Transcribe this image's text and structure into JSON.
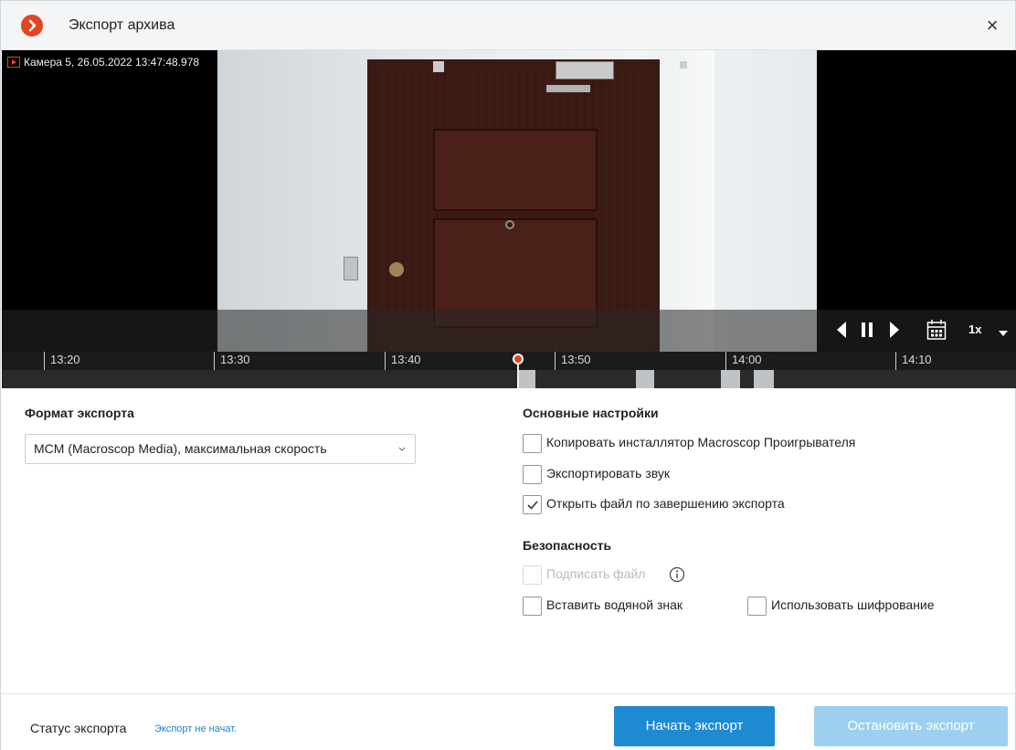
{
  "window": {
    "title": "Экспорт архива",
    "close_label": "×",
    "accent_color": "#e2451f",
    "primary_color": "#1e8ad2"
  },
  "video": {
    "camera_label": "Камера 5, 26.05.2022 13:47:48.978",
    "controls": {
      "prev_icon": "step-back-icon",
      "pause_icon": "pause-icon",
      "next_icon": "step-forward-icon",
      "calendar_icon": "calendar-icon",
      "speed": "1x",
      "speed_menu_icon": "chevron-down-icon"
    }
  },
  "timeline": {
    "ticks": [
      "13:20",
      "13:30",
      "13:40",
      "13:50",
      "14:00",
      "14:10"
    ],
    "current_time": "13:47:48.978"
  },
  "export_format": {
    "title": "Формат экспорта",
    "selected": "MCM (Macroscop Media), максимальная скорость"
  },
  "main_settings": {
    "title": "Основные настройки",
    "options": [
      {
        "label": "Копировать инсталлятор Macroscop Проигрывателя",
        "checked": false,
        "enabled": true
      },
      {
        "label": "Экспортировать звук",
        "checked": false,
        "enabled": true
      },
      {
        "label": "Открыть файл по завершению экспорта",
        "checked": true,
        "enabled": true
      }
    ]
  },
  "security": {
    "title": "Безопасность",
    "sign_file": {
      "label": "Подписать файл",
      "checked": false,
      "enabled": false
    },
    "watermark": {
      "label": "Вставить водяной знак",
      "checked": false,
      "enabled": true
    },
    "encryption": {
      "label": "Использовать шифрование",
      "checked": false,
      "enabled": true
    }
  },
  "footer": {
    "status_label": "Статус экспорта",
    "status_value": "Экспорт не начат.",
    "start_button": "Начать экспорт",
    "stop_button": "Остановить экспорт"
  }
}
